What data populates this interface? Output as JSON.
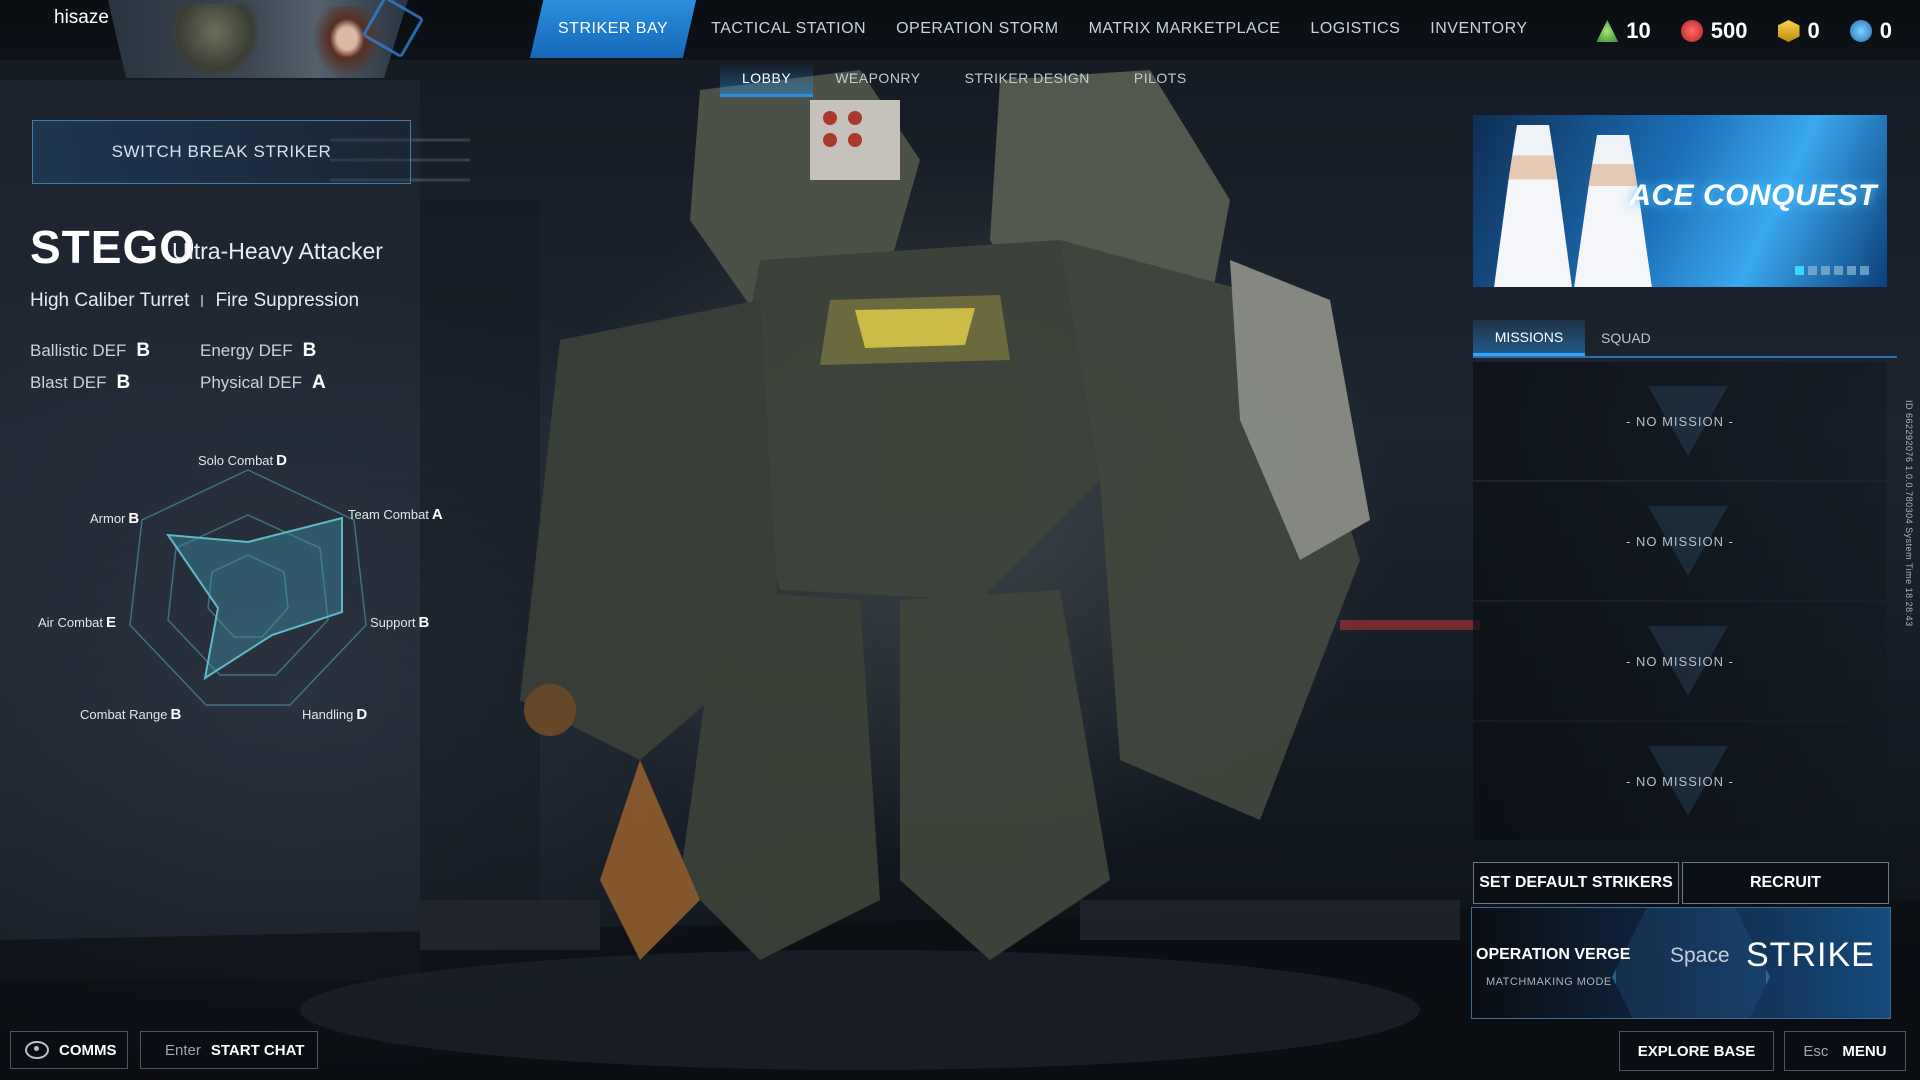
{
  "player": {
    "name": "hisaze"
  },
  "nav": {
    "items": [
      "STRIKER BAY",
      "TACTICAL STATION",
      "OPERATION STORM",
      "MATRIX MARKETPLACE",
      "LOGISTICS",
      "INVENTORY"
    ],
    "active": "STRIKER BAY"
  },
  "currencies": [
    {
      "icon": "green-triangle-currency-icon",
      "value": "10"
    },
    {
      "icon": "red-crest-currency-icon",
      "value": "500"
    },
    {
      "icon": "gold-hex-currency-icon",
      "value": "0"
    },
    {
      "icon": "blue-coin-currency-icon",
      "value": "0"
    }
  ],
  "subnav": {
    "items": [
      "LOBBY",
      "WEAPONRY",
      "STRIKER DESIGN",
      "PILOTS"
    ],
    "active": "LOBBY"
  },
  "striker": {
    "switch_label": "SWITCH BREAK STRIKER",
    "name": "STEGO",
    "class": "Ultra-Heavy Attacker",
    "traits": [
      "High Caliber Turret",
      "Fire Suppression"
    ],
    "defense": [
      {
        "label": "Ballistic DEF",
        "grade": "B"
      },
      {
        "label": "Energy DEF",
        "grade": "B"
      },
      {
        "label": "Blast DEF",
        "grade": "B"
      },
      {
        "label": "Physical DEF",
        "grade": "A"
      }
    ],
    "radar": [
      {
        "label": "Solo Combat",
        "grade": "D"
      },
      {
        "label": "Team Combat",
        "grade": "A"
      },
      {
        "label": "Support",
        "grade": "B"
      },
      {
        "label": "Handling",
        "grade": "D"
      },
      {
        "label": "Combat Range",
        "grade": "B"
      },
      {
        "label": "Air Combat",
        "grade": "E"
      },
      {
        "label": "Armor",
        "grade": "B"
      }
    ]
  },
  "banner": {
    "title": "ACE CONQUEST",
    "dots": 6,
    "active_dot": 0
  },
  "tabs": {
    "items": [
      "MISSIONS",
      "SQUAD"
    ],
    "active": "MISSIONS"
  },
  "missions": [
    "NO MISSION",
    "NO MISSION",
    "NO MISSION",
    "NO MISSION"
  ],
  "actions": {
    "set_default": "SET DEFAULT STRIKERS",
    "recruit": "RECRUIT"
  },
  "strike": {
    "operation": "OPERATION VERGE",
    "mode": "MATCHMAKING MODE",
    "key": "Space",
    "label": "STRIKE"
  },
  "side_info": "ID 662292076   1.0.0.780304   System Time   18:28:43",
  "bottom": {
    "comms": "COMMS",
    "chat_key": "Enter",
    "chat_label": "START CHAT",
    "explore": "EXPLORE BASE",
    "menu_key": "Esc",
    "menu_label": "MENU"
  }
}
